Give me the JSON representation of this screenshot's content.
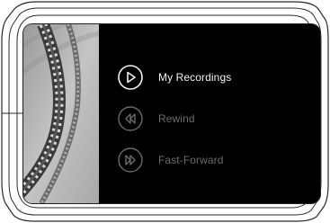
{
  "menu": {
    "items": [
      {
        "label": "My Recordings",
        "icon": "play-icon",
        "state": "active"
      },
      {
        "label": "Rewind",
        "icon": "rewind-icon",
        "state": "inactive"
      },
      {
        "label": "Fast-Forward",
        "icon": "fast-forward-icon",
        "state": "inactive"
      }
    ]
  },
  "colors": {
    "screen_bg": "#000000",
    "active_text": "#f2f2f2",
    "inactive_text": "#6b6b6b",
    "film_panel_bg": "#b8b8b8"
  }
}
